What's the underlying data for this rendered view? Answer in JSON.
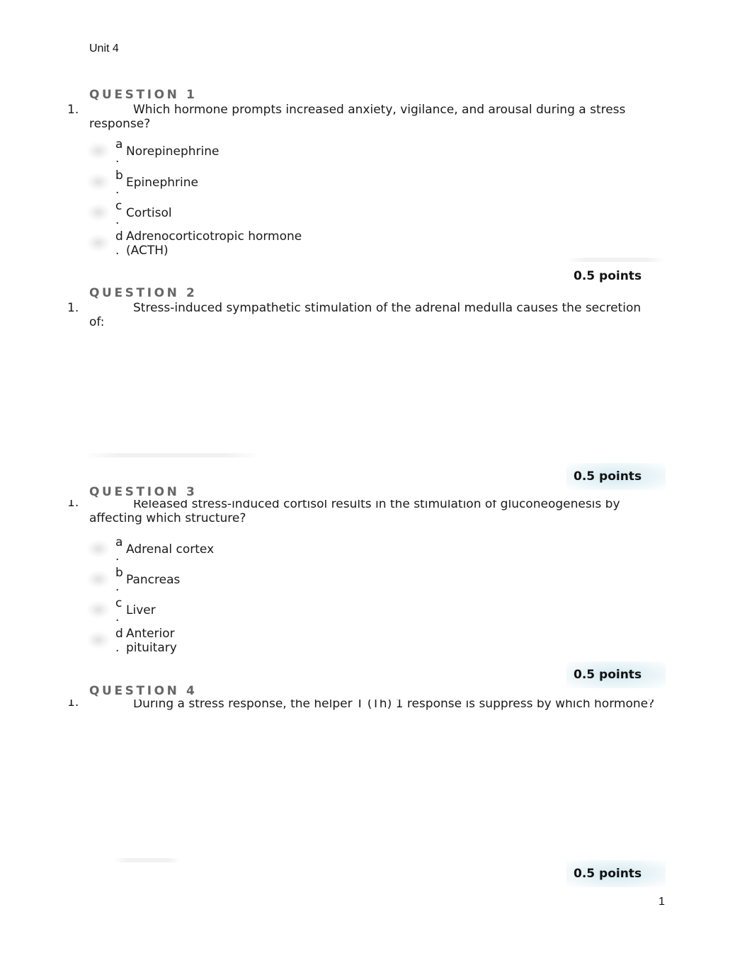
{
  "document": {
    "title": "Unit 4",
    "page_number": "1"
  },
  "questions": [
    {
      "heading": "QUESTION 1",
      "number": "1.",
      "text": "Which hormone prompts increased anxiety, vigilance, and arousal during a stress response?",
      "points": "0.5 points",
      "answers": [
        {
          "letter": "a",
          "text": "Norepinephrine"
        },
        {
          "letter": "b",
          "text": "Epinephrine"
        },
        {
          "letter": "c",
          "text": "Cortisol"
        },
        {
          "letter": "d",
          "text": "Adrenocorticotropic hormone (ACTH)"
        }
      ]
    },
    {
      "heading": "QUESTION 2",
      "number": "1.",
      "text": "Stress-induced sympathetic stimulation of the adrenal medulla causes the secretion of:",
      "points": "0.5 points",
      "answers": []
    },
    {
      "heading": "QUESTION 3",
      "number": "1.",
      "text": "Released stress-induced cortisol results in the stimulation of gluconeogenesis by affecting which structure?",
      "points": "0.5 points",
      "answers": [
        {
          "letter": "a",
          "text": "Adrenal cortex"
        },
        {
          "letter": "b",
          "text": "Pancreas"
        },
        {
          "letter": "c",
          "text": "Liver"
        },
        {
          "letter": "d",
          "text": "Anterior pituitary"
        }
      ]
    },
    {
      "heading": "QUESTION 4",
      "number": "1.",
      "text": "During a stress response, the helper T (Th) 1 response is suppress by which hormone?",
      "points": "0.5 points",
      "answers": []
    }
  ]
}
